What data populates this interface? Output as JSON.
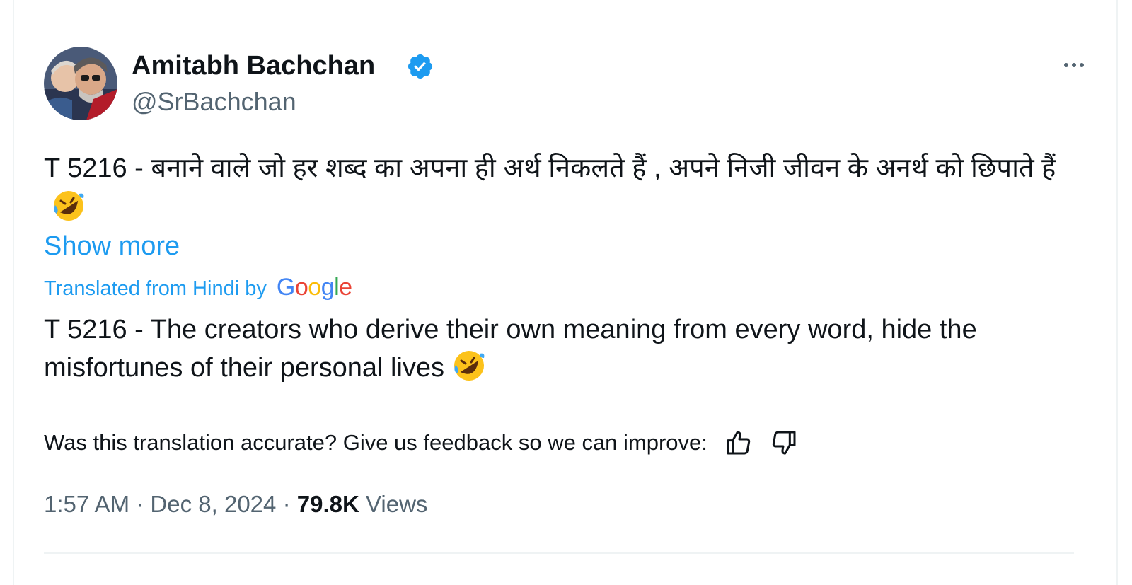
{
  "author": {
    "display_name": "Amitabh Bachchan",
    "handle": "@SrBachchan",
    "verified": true,
    "verified_color": "#1d9bf0",
    "avatar_icon": "profile-photo"
  },
  "actions": {
    "more_icon": "more-horizontal-icon"
  },
  "tweet": {
    "text": "T 5216 - बनाने वाले जो हर शब्द का अपना ही अर्थ निकलते हैं  ,  अपने निजी जीवन के अनर्थ को छिपाते हैं",
    "emoji": "rolling-on-floor-laughing-emoji",
    "show_more_label": "Show more"
  },
  "translation": {
    "label": "Translated from Hindi by",
    "provider": "Google",
    "text": "T 5216 - The creators who derive their own meaning from every word, hide the misfortunes of their personal lives",
    "emoji": "rolling-on-floor-laughing-emoji",
    "feedback_prompt": "Was this translation accurate? Give us feedback so we can improve:"
  },
  "meta": {
    "time": "1:57 AM",
    "separator": "·",
    "date": "Dec 8, 2024",
    "views_count": "79.8K",
    "views_label": "Views"
  },
  "colors": {
    "accent": "#1d9bf0",
    "text_primary": "#0f1419",
    "text_secondary": "#536471",
    "border": "#eff3f4"
  }
}
